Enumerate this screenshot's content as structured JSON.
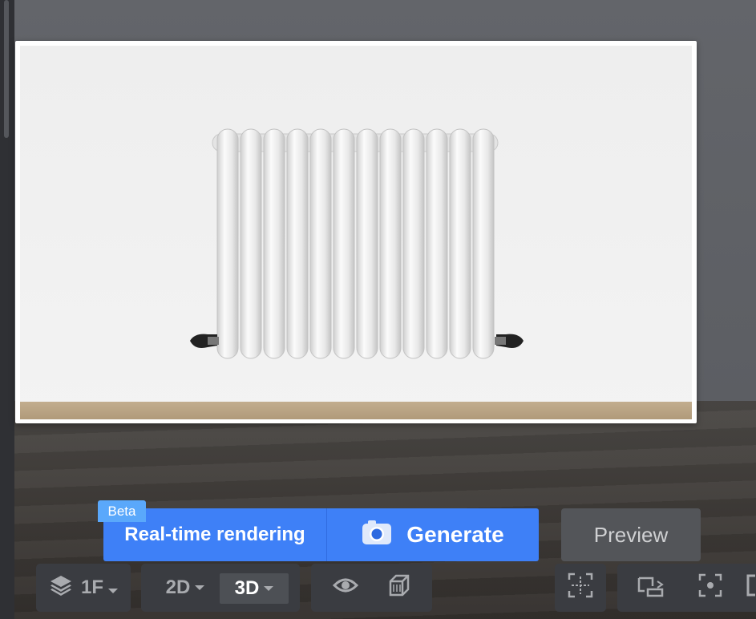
{
  "render": {
    "beta_label": "Beta",
    "realtime_label": "Real-time rendering",
    "generate_label": "Generate",
    "preview_label": "Preview"
  },
  "toolbar": {
    "floor_label": "1F",
    "view_2d_label": "2D",
    "view_3d_label": "3D",
    "active_view": "3D"
  },
  "icons": {
    "layers": "layers-icon",
    "camera": "camera-icon",
    "eye": "eye-icon",
    "cube": "cube-icon",
    "grid_select": "grid-select-icon",
    "screen_rotate": "screen-rotate-icon",
    "focus": "focus-icon"
  },
  "colors": {
    "accent": "#3e80f7",
    "badge": "#5aa8fb",
    "toolbar_bg": "#3a3c41",
    "preview_button_bg": "#535559"
  }
}
